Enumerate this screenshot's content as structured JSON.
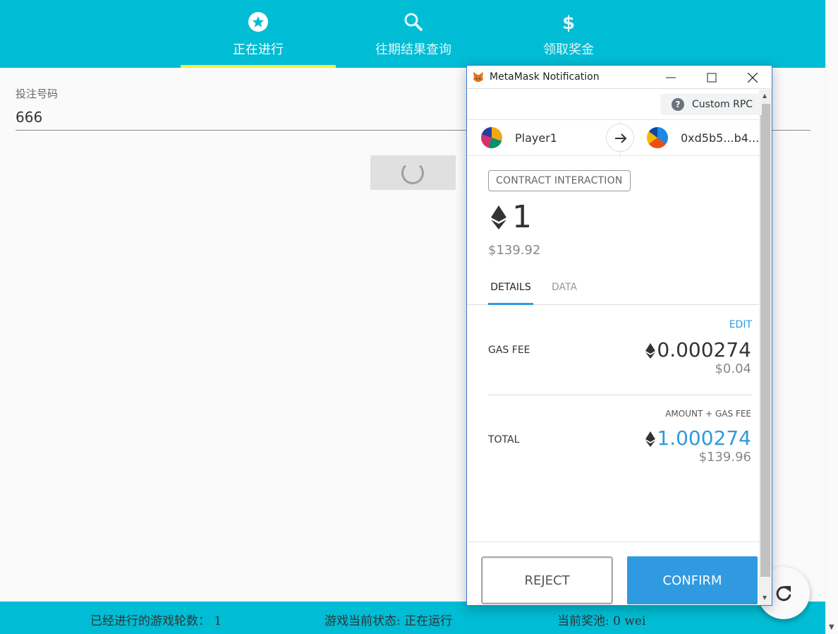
{
  "nav": {
    "tabs": [
      {
        "label": "正在进行",
        "icon": "star-circle-icon"
      },
      {
        "label": "往期结果查询",
        "icon": "search-icon"
      },
      {
        "label": "领取奖金",
        "icon": "dollar-icon"
      }
    ],
    "active_index": 0
  },
  "form": {
    "label": "投注号码",
    "value": "666"
  },
  "footer": {
    "rounds": "已经进行的游戏轮数： 1",
    "status": "游戏当前状态: 正在运行",
    "pool": "当前奖池: 0 wei"
  },
  "metamask": {
    "window_title": "MetaMask Notification",
    "network": "Custom RPC",
    "from_account": "Player1",
    "to_account": "0xd5b5...b4...",
    "badge": "CONTRACT INTERACTION",
    "amount": "1",
    "amount_fiat": "$139.92",
    "tabs": {
      "details": "DETAILS",
      "data": "DATA"
    },
    "edit": "EDIT",
    "gas_fee_label": "GAS FEE",
    "gas_fee_eth": "0.000274",
    "gas_fee_fiat": "$0.04",
    "amount_gas_label": "AMOUNT + GAS FEE",
    "total_label": "TOTAL",
    "total_eth": "1.000274",
    "total_fiat": "$139.96",
    "reject": "REJECT",
    "confirm": "CONFIRM"
  },
  "colors": {
    "primary": "#00bcd4",
    "indicator": "#ffeb3b",
    "metamask_blue": "#2f9ae0"
  }
}
